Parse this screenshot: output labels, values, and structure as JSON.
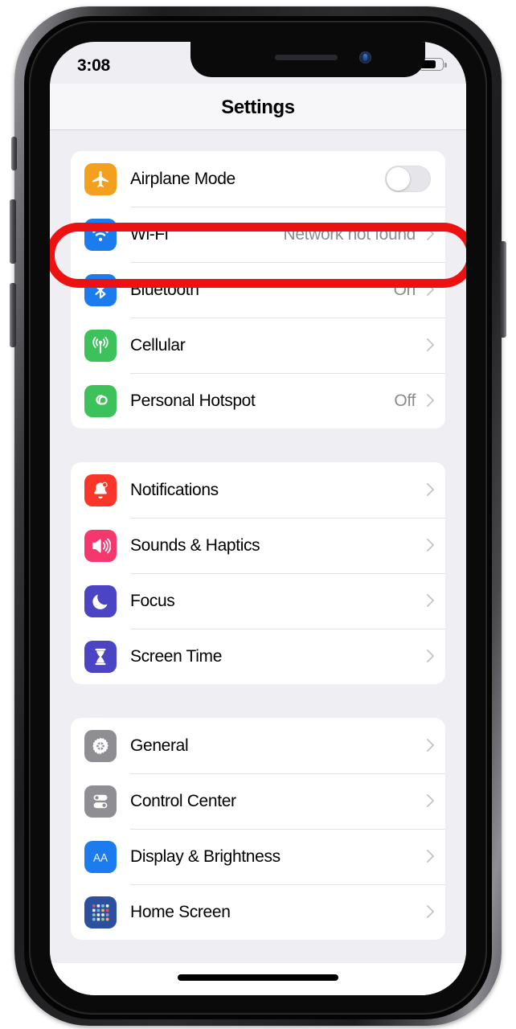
{
  "device": {
    "name": "iphone-x-frame"
  },
  "status_bar": {
    "time": "3:08",
    "signal_icon": "cellular-signal-icon",
    "wifi_icon": "wifi-icon",
    "battery_icon": "battery-icon",
    "battery_level_pct": 72
  },
  "navbar": {
    "title": "Settings"
  },
  "annotation": {
    "target": "wifi-row",
    "shape": "rounded-rectangle-outline",
    "color": "#ee1111"
  },
  "groups": [
    {
      "id": "connectivity",
      "rows": [
        {
          "label": "Airplane Mode",
          "value": "",
          "icon": "airplane-icon",
          "accessory": "toggle",
          "toggle_on": false
        },
        {
          "label": "Wi-Fi",
          "value": "Network not found",
          "icon": "wifi-icon",
          "accessory": "chevron",
          "highlighted": true
        },
        {
          "label": "Bluetooth",
          "value": "On",
          "icon": "bluetooth-icon",
          "accessory": "chevron"
        },
        {
          "label": "Cellular",
          "value": "",
          "icon": "cellular-antenna-icon",
          "accessory": "chevron"
        },
        {
          "label": "Personal Hotspot",
          "value": "Off",
          "icon": "personal-hotspot-icon",
          "accessory": "chevron"
        }
      ]
    },
    {
      "id": "alerts",
      "rows": [
        {
          "label": "Notifications",
          "value": "",
          "icon": "bell-icon",
          "accessory": "chevron"
        },
        {
          "label": "Sounds & Haptics",
          "value": "",
          "icon": "speaker-icon",
          "accessory": "chevron"
        },
        {
          "label": "Focus",
          "value": "",
          "icon": "moon-icon",
          "accessory": "chevron"
        },
        {
          "label": "Screen Time",
          "value": "",
          "icon": "hourglass-icon",
          "accessory": "chevron"
        }
      ]
    },
    {
      "id": "system",
      "rows": [
        {
          "label": "General",
          "value": "",
          "icon": "gear-icon",
          "accessory": "chevron"
        },
        {
          "label": "Control Center",
          "value": "",
          "icon": "control-center-icon",
          "accessory": "chevron"
        },
        {
          "label": "Display & Brightness",
          "value": "",
          "icon": "display-brightness-icon",
          "accessory": "chevron"
        },
        {
          "label": "Home Screen",
          "value": "",
          "icon": "home-screen-icon",
          "accessory": "chevron"
        }
      ]
    }
  ],
  "colors": {
    "airplane": "#f2a01d",
    "wifi": "#1c7ced",
    "bluetooth": "#1c7ced",
    "cellular": "#3dc25b",
    "hotspot": "#3dc25b",
    "notifications": "#f8372a",
    "sounds": "#f4376d",
    "focus": "#4b44c4",
    "screen_time": "#4b44c4",
    "general": "#8e8e93",
    "control_center": "#8e8e93",
    "display": "#1c7ced",
    "home_screen": "#2c4f9e",
    "annotation_red": "#ee1111",
    "value_gray": "#8b8b90",
    "page_bg": "#eeeef3"
  }
}
